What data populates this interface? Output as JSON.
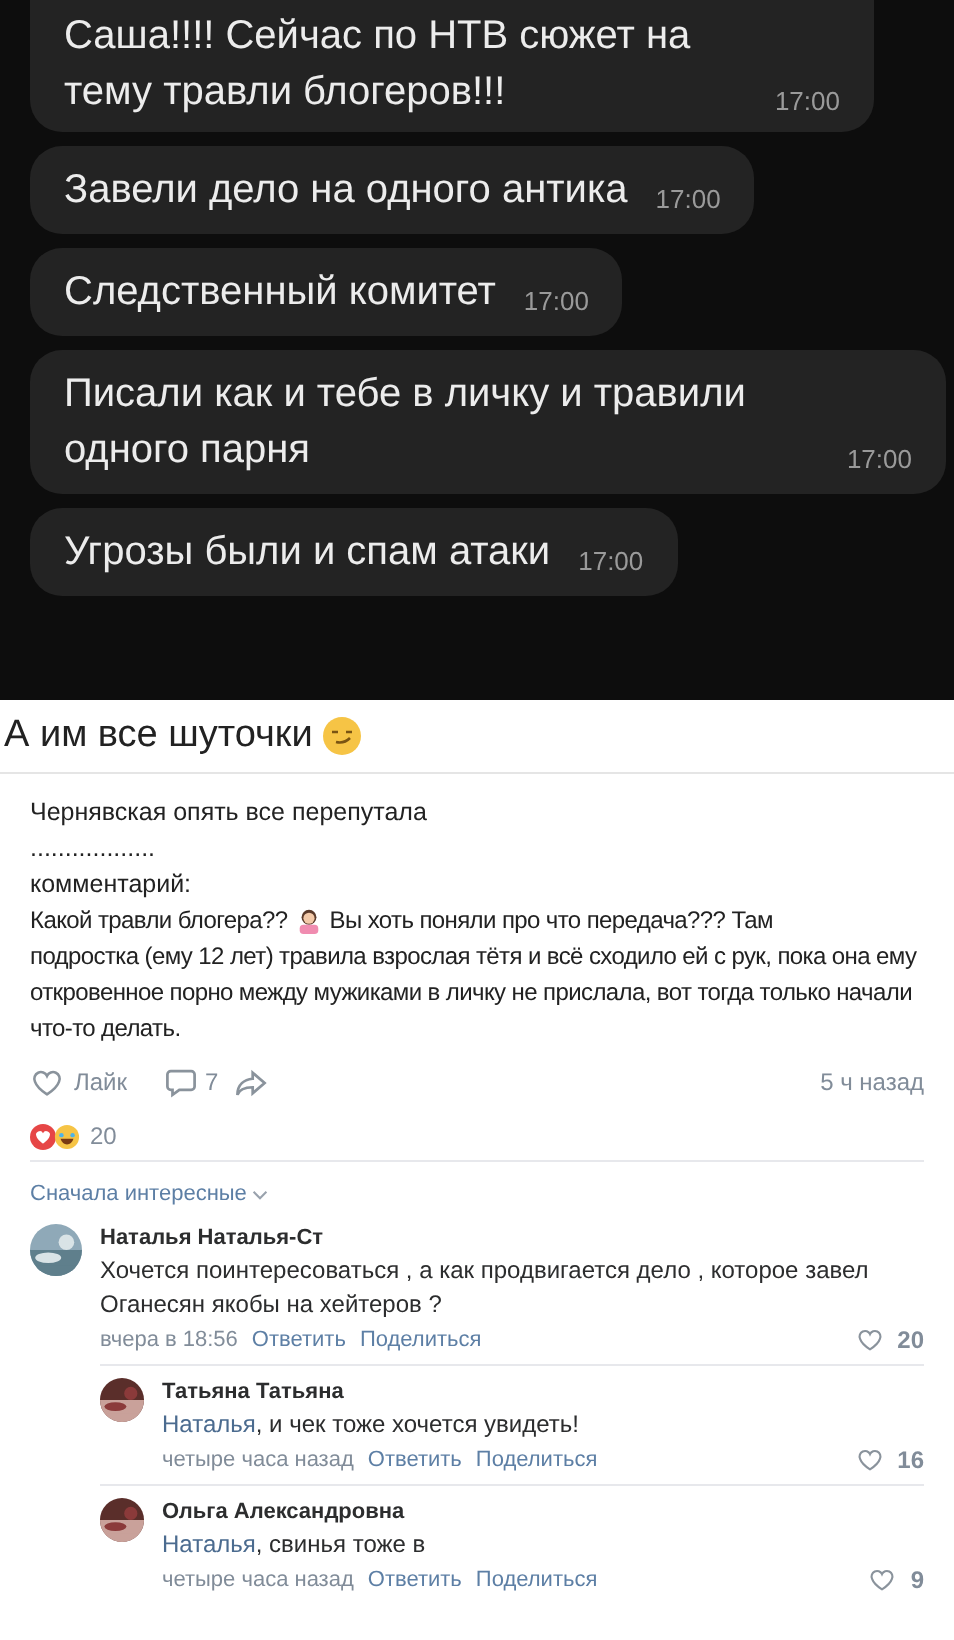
{
  "chat": {
    "messages": [
      {
        "text": "Саша!!!! Сейчас по НТВ сюжет на тему травли блогеров!!!",
        "time": "17:00"
      },
      {
        "text": "Завели дело на одного антика",
        "time": "17:00"
      },
      {
        "text": "Следственный комитет",
        "time": "17:00"
      },
      {
        "text": "Писали как и тебе в личку и травили одного парня",
        "time": "17:00"
      },
      {
        "text": "Угрозы были и спам атаки",
        "time": "17:00"
      }
    ]
  },
  "post": {
    "title": "А им все шуточки",
    "lines": [
      "Чернявская опять все перепутала",
      "..................",
      "комментарий:"
    ],
    "body_start": "Какой травли блогера??",
    "body_rest_first": "Вы хоть поняли про что передача??? Там",
    "body_rest": "подростка (ему 12 лет) травила взрослая тётя и всё сходило ей с рук, пока она ему откровенное порно между мужиками в личку не прислала, вот тогда только начали что-то делать.",
    "like_label": "Лайк",
    "comments_count": "7",
    "time": "5 ч назад",
    "reactions_count": "20"
  },
  "sort_label": "Сначала интересные",
  "comments": [
    {
      "author": "Наталья Наталья-Ст",
      "text": "Хочется поинтересоваться , а как продвигается дело , которое завел Оганесян якобы на хейтеров ?",
      "time": "вчера в 18:56",
      "reply": "Ответить",
      "share": "Поделиться",
      "likes": "20",
      "children": [
        {
          "author": "Татьяна Татьяна",
          "mention": "Наталья",
          "text": ", и чек тоже хочется увидеть!",
          "time": "четыре часа назад",
          "reply": "Ответить",
          "share": "Поделиться",
          "likes": "16"
        },
        {
          "author": "Ольга Александровна",
          "mention": "Наталья",
          "text": ", свинья тоже в",
          "time": "четыре часа назад",
          "reply": "Ответить",
          "share": "Поделиться",
          "likes": "9"
        }
      ]
    }
  ]
}
